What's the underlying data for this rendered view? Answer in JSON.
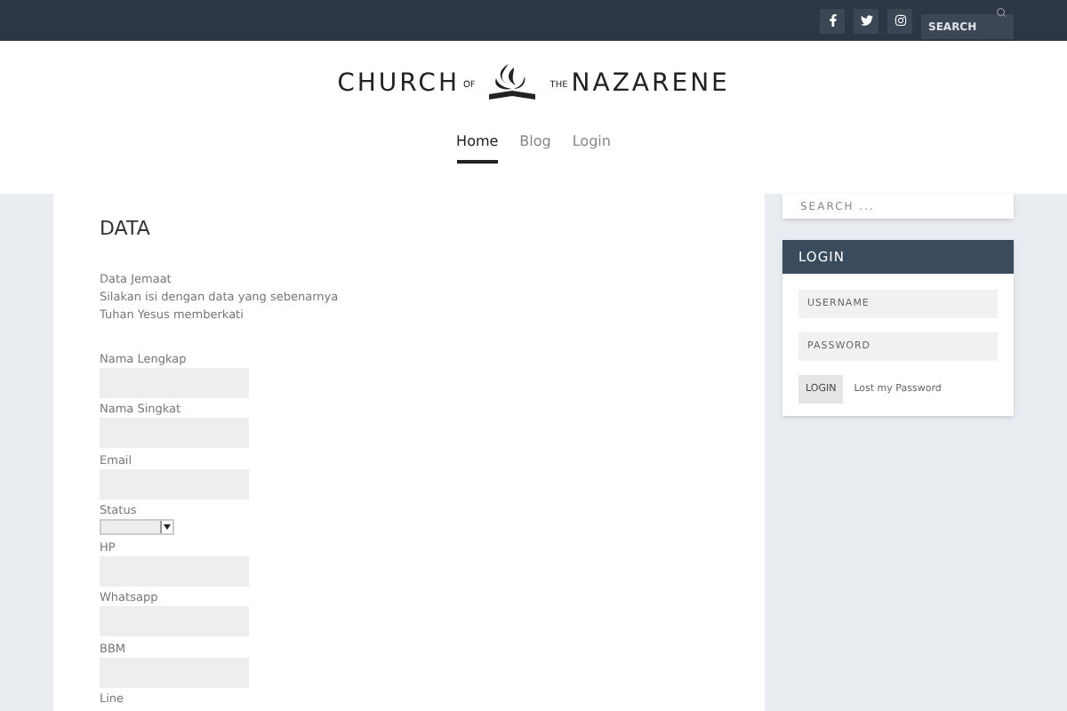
{
  "top_bar": {
    "search_placeholder": "SEARCH"
  },
  "logo": {
    "left": "CHURCH",
    "small_left": "OF",
    "small_right": "THE",
    "right": "NAZARENE"
  },
  "nav": [
    {
      "label": "Home",
      "selected": true
    },
    {
      "label": "Blog",
      "selected": false
    },
    {
      "label": "Login",
      "selected": false
    }
  ],
  "main": {
    "title": "DATA",
    "intro": [
      "Data Jemaat",
      "Silakan isi dengan data yang sebenarnya",
      "Tuhan Yesus memberkati"
    ],
    "fields": [
      {
        "label": "Nama Lengkap",
        "kind": "text"
      },
      {
        "label": "Nama Singkat",
        "kind": "text"
      },
      {
        "label": "Email",
        "kind": "text"
      },
      {
        "label": "Status",
        "kind": "select"
      },
      {
        "label": "HP",
        "kind": "text"
      },
      {
        "label": "Whatsapp",
        "kind": "text"
      },
      {
        "label": "BBM",
        "kind": "text"
      },
      {
        "label": "Line",
        "kind": "label"
      }
    ]
  },
  "sidebar": {
    "search_placeholder": "SEARCH ...",
    "login": {
      "title": "LOGIN",
      "username_placeholder": "USERNAME",
      "password_placeholder": "PASSWORD",
      "button": "LOGIN",
      "link": "Lost my Password"
    }
  }
}
